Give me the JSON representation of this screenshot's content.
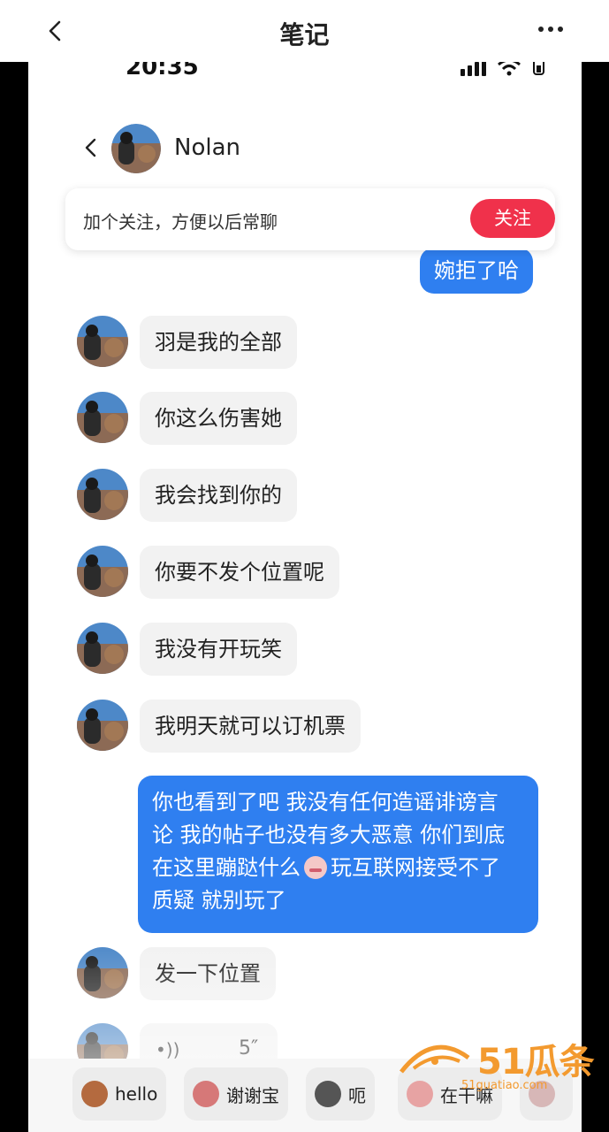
{
  "app_nav": {
    "title": "笔记",
    "back_icon": "chevron-left-icon",
    "more_icon": "more-horizontal-icon"
  },
  "status_bar": {
    "time": "20:35"
  },
  "chat_header": {
    "name": "Nolan"
  },
  "follow_card": {
    "text": "加个关注，方便以后常聊",
    "button": "关注"
  },
  "messages": [
    {
      "side": "out",
      "text": "婉拒了哈"
    },
    {
      "side": "in",
      "text": "羽是我的全部"
    },
    {
      "side": "in",
      "text": "你这么伤害她"
    },
    {
      "side": "in",
      "text": "我会找到你的"
    },
    {
      "side": "in",
      "text": "你要不发个位置呢"
    },
    {
      "side": "in",
      "text": "我没有开玩笑"
    },
    {
      "side": "in",
      "text": "我明天就可以订机票"
    },
    {
      "side": "out",
      "lines": [
        "你也看到了吧 我没有任何造谣诽谤言",
        "论 我的帖子也没有多大恶意 你们到底",
        "在这里蹦跶什么",
        "玩互联网接受不了",
        "质疑 就别玩了"
      ]
    },
    {
      "side": "in",
      "text": "发一下位置"
    },
    {
      "side": "in",
      "type": "voice",
      "duration": "5″"
    }
  ],
  "quick_replies": [
    "hello",
    "谢谢宝",
    "呃",
    "在干嘛"
  ],
  "watermark": {
    "main": "51瓜条",
    "sub": "51guatiao.com"
  }
}
